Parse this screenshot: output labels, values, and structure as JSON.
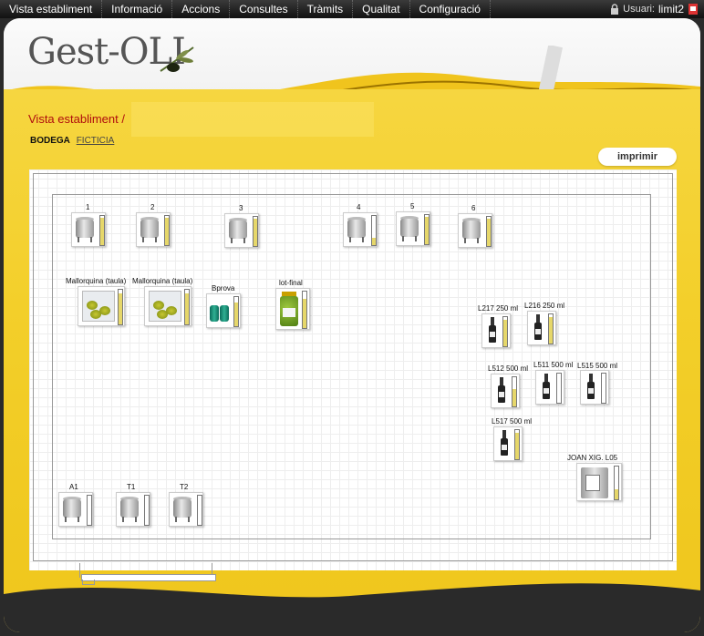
{
  "nav": {
    "items": [
      "Vista establiment",
      "Informació",
      "Accions",
      "Consultes",
      "Tràmits",
      "Qualitat",
      "Configuració"
    ],
    "user_label": "Usuari:",
    "user_name": "limit2"
  },
  "header": {
    "logo_text": "Gest-OLI"
  },
  "breadcrumb": {
    "text": "Vista establiment /"
  },
  "bodega": {
    "label": "BODEGA",
    "name": "FICTICIA"
  },
  "print_button": "imprimir",
  "tanks": [
    {
      "label": "1",
      "level": 0.95
    },
    {
      "label": "2",
      "level": 0.95
    },
    {
      "label": "3",
      "level": 0.95
    },
    {
      "label": "4",
      "level": 0.25
    },
    {
      "label": "5",
      "level": 0.95
    },
    {
      "label": "6",
      "level": 0.95
    },
    {
      "label": "A1",
      "level": 0.0
    },
    {
      "label": "T1",
      "level": 0.0
    },
    {
      "label": "T2",
      "level": 0.0
    }
  ],
  "olive_containers": [
    {
      "label": "Mallorquina (taula)",
      "level": 0.9
    },
    {
      "label": "Mallorquina (taula)",
      "level": 0.9
    }
  ],
  "barrel": {
    "label": "Bprova",
    "level": 0.8
  },
  "jar": {
    "label": "lot-final",
    "level": 0.8
  },
  "bottles": [
    {
      "label": "L217 250 ml",
      "level": 0.9
    },
    {
      "label": "L216 250 ml",
      "level": 0.9
    },
    {
      "label": "L512 500 ml",
      "level": 0.6
    },
    {
      "label": "L511 500 ml",
      "level": 0.0
    },
    {
      "label": "L515 500 ml",
      "level": 0.0
    },
    {
      "label": "L517 500 ml",
      "level": 0.9
    }
  ],
  "tin": {
    "label": "JOAN XIG. L05",
    "level": 0.3
  },
  "colors": {
    "accent_red": "#b00d0d",
    "yellow": "#f3cf2a",
    "gauge_fill": "#e6d76a"
  },
  "icons": {
    "lock": "lock-icon",
    "user_flag": "user-flag-icon"
  }
}
